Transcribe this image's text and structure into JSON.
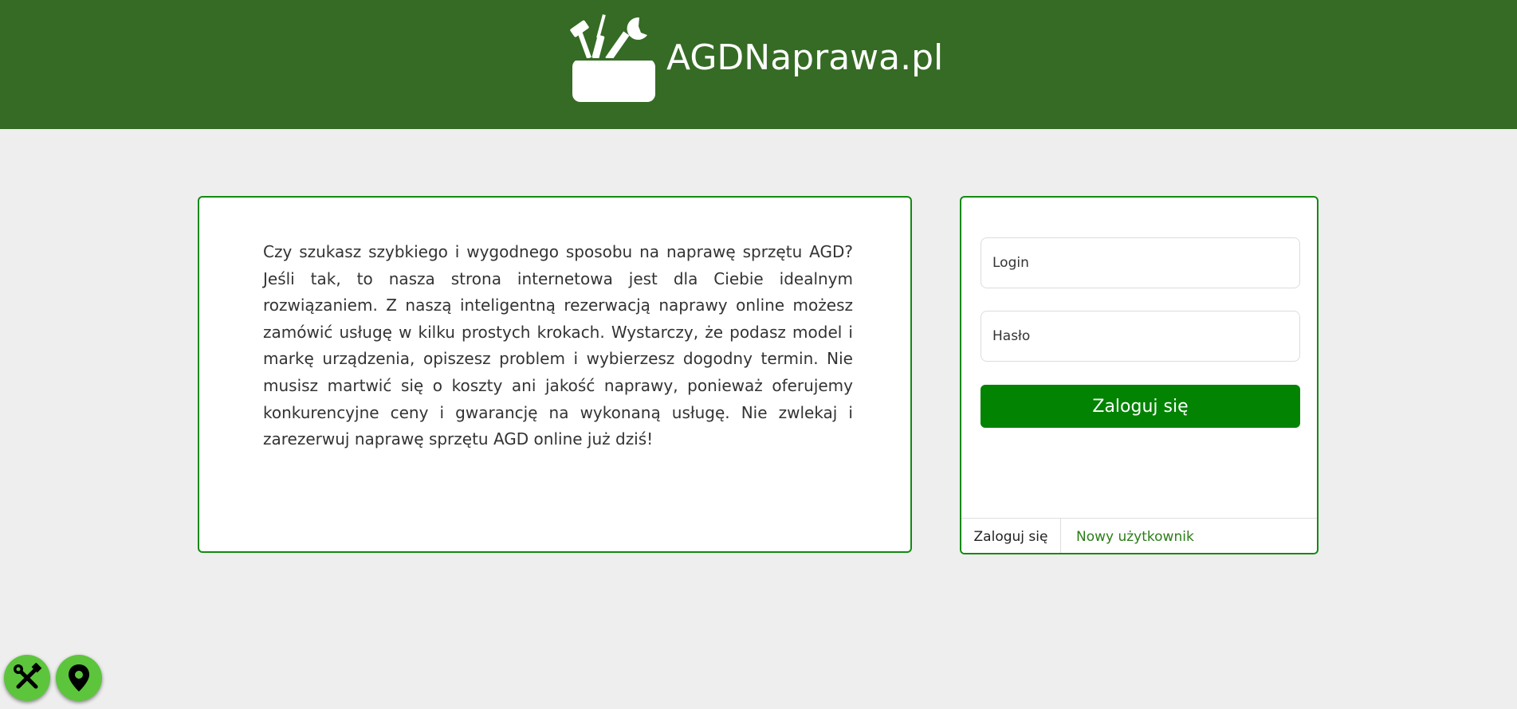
{
  "header": {
    "site_name": "AGDNaprawa.pl",
    "logo_icon": "toolbox-icon"
  },
  "info": {
    "text": "Czy szukasz szybkiego i wygodnego sposobu na naprawę sprzętu AGD? Jeśli tak, to nasza strona internetowa jest dla Ciebie idealnym rozwiązaniem. Z naszą inteligentną rezerwacją naprawy online możesz zamówić usługę w kilku prostych krokach. Wystarczy, że podasz model i markę urządzenia, opiszesz problem i wybierzesz dogodny termin. Nie musisz martwić się o koszty ani jakość naprawy, ponieważ oferujemy konkurencyjne ceny i gwarancję na wykonaną usługę. Nie zwlekaj i zarezerwuj naprawę sprzętu AGD online już dziś!"
  },
  "login_form": {
    "login_placeholder": "Login",
    "password_placeholder": "Hasło",
    "submit_label": "Zaloguj się",
    "tabs": {
      "login": "Zaloguj się",
      "register": "Nowy użytkownik"
    }
  },
  "floating_buttons": {
    "tools_icon": "tools-icon",
    "location_icon": "map-pin-icon"
  },
  "colors": {
    "header_bg": "#356b24",
    "primary_button": "#028302",
    "card_border": "#138a13",
    "fab_bg": "#5cc53c",
    "page_bg": "#eeeeee"
  }
}
